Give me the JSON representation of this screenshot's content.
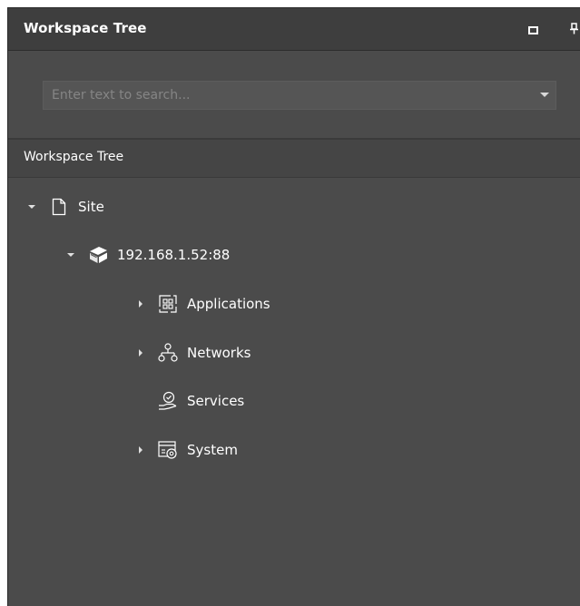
{
  "panel": {
    "title": "Workspace Tree",
    "icons": {
      "maximize": "maximize-icon",
      "pin": "pin-icon"
    }
  },
  "search": {
    "placeholder": "Enter text to search...",
    "value": ""
  },
  "section": {
    "title": "Workspace Tree"
  },
  "tree": {
    "site": {
      "label": "Site",
      "icon": "document-icon",
      "expanded": true
    },
    "server": {
      "label": "192.168.1.52:88",
      "icon": "server-icon",
      "expanded": true
    },
    "children": [
      {
        "label": "Applications",
        "icon": "applications-grid-icon",
        "expandable": true
      },
      {
        "label": "Networks",
        "icon": "network-topology-icon",
        "expandable": true
      },
      {
        "label": "Services",
        "icon": "services-hand-icon",
        "expandable": false
      },
      {
        "label": "System",
        "icon": "system-settings-icon",
        "expandable": true
      }
    ]
  },
  "colors": {
    "panel_bg": "#4b4b4b",
    "titlebar_bg": "#3e3e3e",
    "header_bg": "#454545",
    "text": "#ffffff",
    "placeholder": "#858585"
  }
}
